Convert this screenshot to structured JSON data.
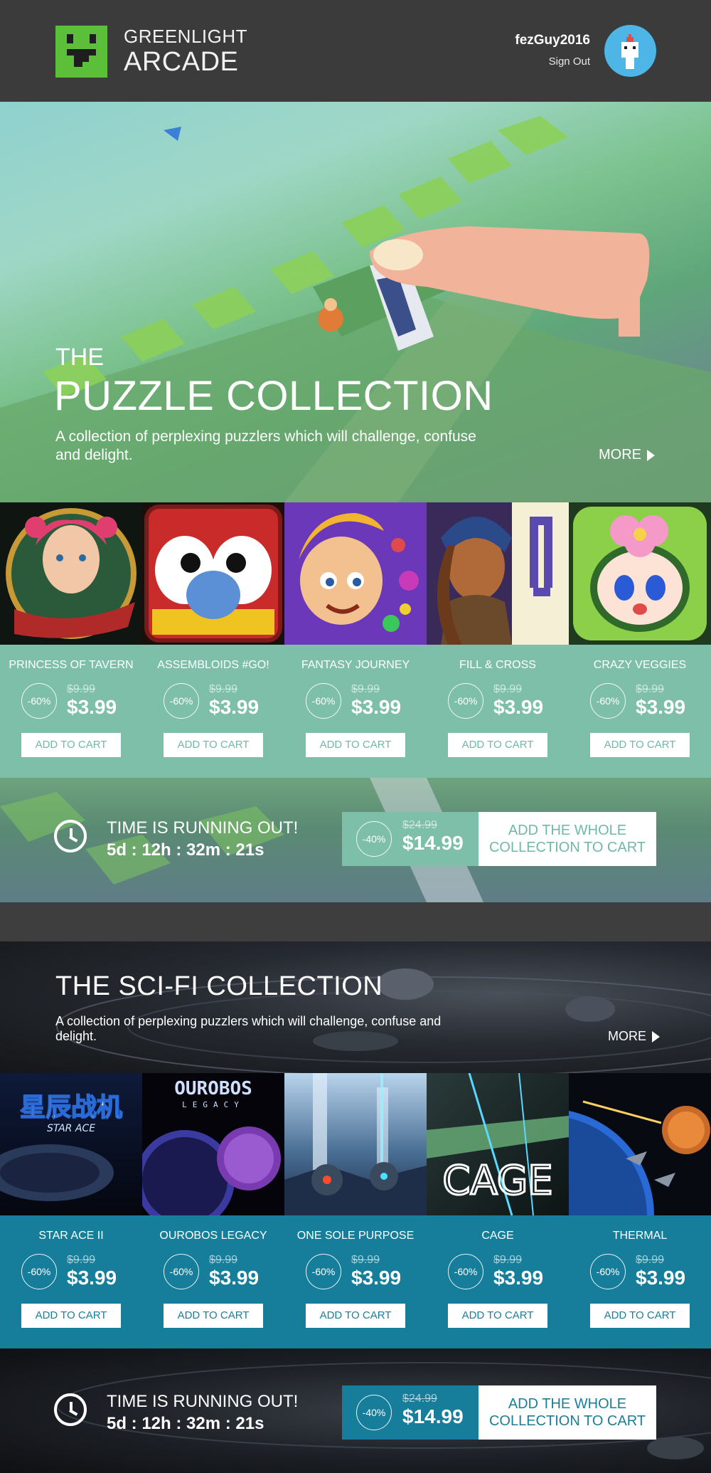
{
  "header": {
    "brand_line1": "GREENLIGHT",
    "brand_line2": "ARCADE",
    "username": "fezGuy2016",
    "signout": "Sign Out"
  },
  "puzzle": {
    "kicker": "THE",
    "title": "PUZZLE COLLECTION",
    "description": "A collection of perplexing puzzlers which will challenge, confuse and delight.",
    "more": "MORE",
    "accent": "#7ebfa9",
    "products": [
      {
        "name": "PRINCESS OF TAVERN",
        "discount": "-60%",
        "old_price": "$9.99",
        "price": "$3.99",
        "cta": "ADD TO CART"
      },
      {
        "name": "ASSEMBLOIDS #GO!",
        "discount": "-60%",
        "old_price": "$9.99",
        "price": "$3.99",
        "cta": "ADD TO CART"
      },
      {
        "name": "FANTASY JOURNEY",
        "discount": "-60%",
        "old_price": "$9.99",
        "price": "$3.99",
        "cta": "ADD TO CART"
      },
      {
        "name": "FILL & CROSS",
        "discount": "-60%",
        "old_price": "$9.99",
        "price": "$3.99",
        "cta": "ADD TO CART"
      },
      {
        "name": "CRAZY VEGGIES",
        "discount": "-60%",
        "old_price": "$9.99",
        "price": "$3.99",
        "cta": "ADD TO CART"
      }
    ],
    "timer": {
      "label": "TIME IS RUNNING OUT!",
      "value": "5d : 12h : 32m : 21s"
    },
    "bundle": {
      "discount": "-40%",
      "old_price": "$24.99",
      "price": "$14.99",
      "cta": "ADD THE WHOLE COLLECTION TO CART"
    }
  },
  "scifi": {
    "title": "THE SCI-FI COLLECTION",
    "description": "A collection of perplexing puzzlers which will challenge, confuse and delight.",
    "more": "MORE",
    "accent": "#167e9a",
    "products": [
      {
        "name": "STAR ACE II",
        "discount": "-60%",
        "old_price": "$9.99",
        "price": "$3.99",
        "cta": "ADD TO CART"
      },
      {
        "name": "OUROBOS LEGACY",
        "discount": "-60%",
        "old_price": "$9.99",
        "price": "$3.99",
        "cta": "ADD TO CART"
      },
      {
        "name": "ONE SOLE PURPOSE",
        "discount": "-60%",
        "old_price": "$9.99",
        "price": "$3.99",
        "cta": "ADD TO CART"
      },
      {
        "name": "CAGE",
        "discount": "-60%",
        "old_price": "$9.99",
        "price": "$3.99",
        "cta": "ADD TO CART"
      },
      {
        "name": "THERMAL",
        "discount": "-60%",
        "old_price": "$9.99",
        "price": "$3.99",
        "cta": "ADD TO CART"
      }
    ],
    "timer": {
      "label": "TIME IS RUNNING OUT!",
      "value": "5d : 12h : 32m : 21s"
    },
    "bundle": {
      "discount": "-40%",
      "old_price": "$24.99",
      "price": "$14.99",
      "cta": "ADD THE WHOLE COLLECTION TO CART"
    }
  },
  "cover_art": {
    "star_ace_title": "星辰战机",
    "star_ace_subtitle": "STAR ACE",
    "ourobos_title": "OUROBOS",
    "ourobos_subtitle": "LEGACY",
    "cage_title": "CAGE"
  }
}
